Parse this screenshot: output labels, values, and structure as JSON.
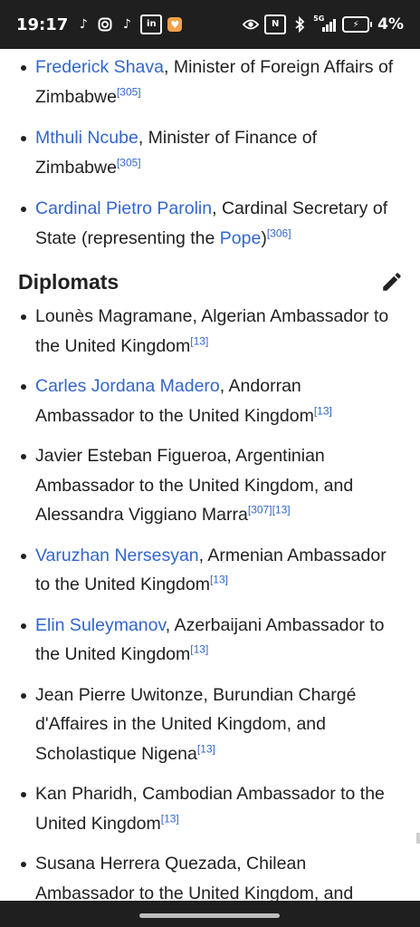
{
  "status_bar": {
    "time": "19:17",
    "battery_percent": "4%",
    "signal_label": "5G",
    "app_icons": [
      "tiktok-icon",
      "instagram-icon",
      "tiktok-icon",
      "linkedin-icon",
      "heart-app-icon"
    ],
    "system_icons": [
      "eye-icon",
      "nfc-icon",
      "bluetooth-icon",
      "signal-icon",
      "battery-charging-icon"
    ]
  },
  "colors": {
    "link": "#3366cc",
    "text": "#202122",
    "status_bar_bg": "#1f1f1f"
  },
  "prev_list": [
    {
      "link": "Frederick Shava",
      "text": ", Minister of Foreign Affairs of Zimbabwe",
      "ref": "[305]"
    },
    {
      "link": "Mthuli Ncube",
      "text": ", Minister of Finance of Zimbabwe",
      "ref": "[305]"
    },
    {
      "link": "Cardinal Pietro Parolin",
      "text": ", Cardinal Secretary of State (representing the ",
      "link2": "Pope",
      "text2": ")",
      "ref": "[306]"
    }
  ],
  "section": {
    "title": "Diplomats",
    "edit_icon": "pencil-icon"
  },
  "diplomats": [
    {
      "text": "Lounès Magramane, Algerian Ambassador to the United Kingdom",
      "ref": "[13]"
    },
    {
      "link": "Carles Jordana Madero",
      "text": ", Andorran Ambassador to the United Kingdom",
      "ref": "[13]"
    },
    {
      "text": "Javier Esteban Figueroa, Argentinian Ambassador to the United Kingdom, and Alessandra Viggiano Marra",
      "ref": "[307]",
      "ref2": "[13]"
    },
    {
      "link": "Varuzhan Nersesyan",
      "text": ", Armenian Ambassador to the United Kingdom",
      "ref": "[13]"
    },
    {
      "link": "Elin Suleymanov",
      "text": ", Azerbaijani Ambassador to the United Kingdom",
      "ref": "[13]"
    },
    {
      "text": "Jean Pierre Uwitonze, Burundian Chargé d'Affaires in the United Kingdom, and Scholastique Nigena",
      "ref": "[13]"
    },
    {
      "text": "Kan Pharidh, Cambodian Ambassador to the United Kingdom",
      "ref": "[13]"
    },
    {
      "text": "Susana Herrera Quezada, Chilean Ambassador to the United Kingdom, and"
    }
  ]
}
